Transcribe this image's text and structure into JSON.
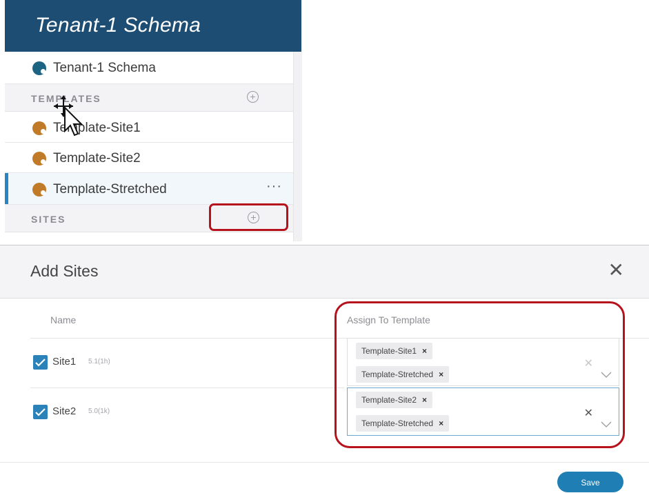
{
  "schema_panel": {
    "header_title": "Tenant-1 Schema",
    "schema_item": "Tenant-1 Schema",
    "templates_section": "TEMPLATES",
    "templates": [
      {
        "label": "Template-Site1"
      },
      {
        "label": "Template-Site2"
      },
      {
        "label": "Template-Stretched",
        "selected": true
      }
    ],
    "more_label": "···",
    "sites_section": "SITES"
  },
  "dialog": {
    "title": "Add Sites",
    "close_label": "✕",
    "columns": {
      "name": "Name",
      "assign": "Assign To Template"
    },
    "sites": [
      {
        "name": "Site1",
        "version": "5.1(1h)",
        "checked": true,
        "templates": [
          "Template-Site1",
          "Template-Stretched"
        ]
      },
      {
        "name": "Site2",
        "version": "5.0(1k)",
        "checked": true,
        "templates": [
          "Template-Site2",
          "Template-Stretched"
        ]
      }
    ],
    "tag_remove": "×",
    "clear_label": "✕",
    "save_label": "Save"
  },
  "colors": {
    "header_bg": "#1d4d72",
    "accent": "#1f7fb5",
    "highlight": "#b5121b",
    "template_icon": "#c07a28",
    "schema_icon": "#1d6483"
  },
  "icons": [
    "add-circle-icon",
    "move-cursor-icon",
    "close-icon",
    "checkmark-icon",
    "chevron-down-icon",
    "more-icon"
  ]
}
